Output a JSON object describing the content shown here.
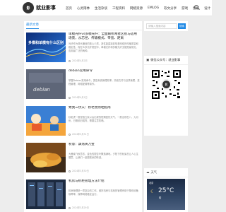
{
  "site": {
    "logo_mark": "影",
    "title": "就业影事"
  },
  "nav": {
    "items": [
      "首页",
      "心灵雨林",
      "生活杂谈",
      "工程资料",
      "网络资源",
      "EMLOG",
      "软文分享",
      "游戏",
      "壁纸",
      "设计"
    ]
  },
  "main": {
    "section_title": "最新文章",
    "posts": [
      {
        "title": "单模光纤vs多模光纤：全面解析两者区别与适用场景，从芯径、传输模式、带宽、距离",
        "excerpt": "光纤作为现代通信的核心介质，其性能直接影响着网络的传输质量和稳定性。而在众多光纤类型中，单模光纤和多模光纤无疑是最常见、应用最广泛的两种。",
        "date": "2024年4月2日",
        "thumb_text": "多模和单模有什么区别"
      },
      {
        "title": "debian常用命令",
        "excerpt": "掌握Debian常用命令，提高系统管理效率。熟悉文件与目录管理、进程管理、网络配置等操作。",
        "date": "2024年4月1日",
        "thumb_text": "debian"
      },
      {
        "title": "致我三伏天：秋老虎防晒指南",
        "excerpt": "秋老虎一般是指立秋以后出现的短期回热天气，一般出现在八、九月份，日照依旧强烈，需要注意防晒。",
        "date": "2024年3月31日",
        "thumb_text": ""
      },
      {
        "title": "秋意：飘落黄万金",
        "excerpt": "大雁南飞秋意浓，金色的银杏叶飘落满地。夕阳下的秋景总让人心生惬意，让我们一起感受秋的味道。",
        "date": "2024年3月30日",
        "thumb_text": ""
      },
      {
        "title": "机房与机柜管理方法介绍",
        "excerpt": "机房管理是一项复杂的工作。做好机房与机柜的管理有助于降低设备故障率，保障网络稳定运行。",
        "date": "2024年3月29日",
        "thumb_text": ""
      }
    ]
  },
  "sidebar": {
    "search": {
      "placeholder": "请输入搜索内容",
      "button": "搜索"
    },
    "wechat": {
      "title": "微信公众号：就业影事"
    },
    "weather": {
      "title": "天气",
      "city": "北京",
      "temp": "25°C",
      "desc": "晴"
    }
  },
  "colors": {
    "accent": "#1e88e5"
  }
}
